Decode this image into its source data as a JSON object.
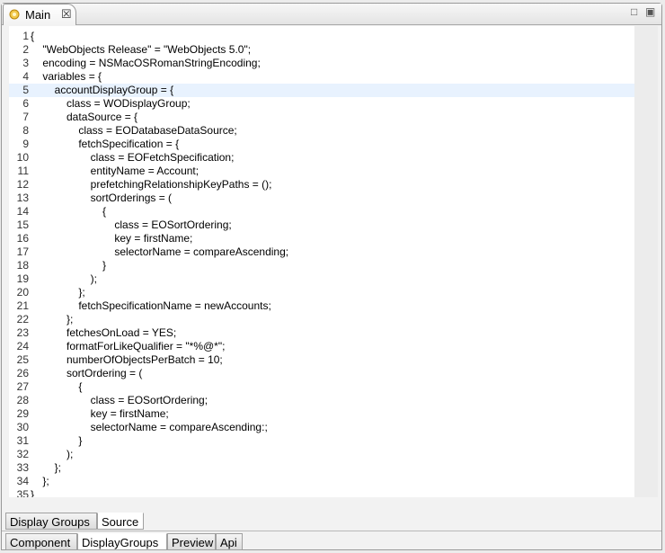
{
  "tab": {
    "title": "Main",
    "close_glyph": "☒"
  },
  "window_controls": {
    "minimize": "□",
    "maximize": "▣"
  },
  "editor": {
    "current_line": 5,
    "lines": [
      "{",
      "    \"WebObjects Release\" = \"WebObjects 5.0\";",
      "    encoding = NSMacOSRomanStringEncoding;",
      "    variables = {",
      "        accountDisplayGroup = {",
      "            class = WODisplayGroup;",
      "            dataSource = {",
      "                class = EODatabaseDataSource;",
      "                fetchSpecification = {",
      "                    class = EOFetchSpecification;",
      "                    entityName = Account;",
      "                    prefetchingRelationshipKeyPaths = ();",
      "                    sortOrderings = (",
      "                        {",
      "                            class = EOSortOrdering;",
      "                            key = firstName;",
      "                            selectorName = compareAscending;",
      "                        }",
      "                    );",
      "                };",
      "                fetchSpecificationName = newAccounts;",
      "            };",
      "            fetchesOnLoad = YES;",
      "            formatForLikeQualifier = \"*%@*\";",
      "            numberOfObjectsPerBatch = 10;",
      "            sortOrdering = (",
      "                {",
      "                    class = EOSortOrdering;",
      "                    key = firstName;",
      "                    selectorName = compareAscending:;",
      "                }",
      "            );",
      "        };",
      "    };",
      "}"
    ]
  },
  "sub_tabs": [
    {
      "label": "Display Groups",
      "active": false
    },
    {
      "label": "Source",
      "active": true
    }
  ],
  "bottom_tabs": [
    {
      "label": "Component",
      "active": false
    },
    {
      "label": "DisplayGroups",
      "active": true
    },
    {
      "label": "Preview",
      "active": false
    },
    {
      "label": "Api",
      "active": false
    }
  ],
  "icons": {
    "tab_icon": "component-icon"
  },
  "colors": {
    "current_line_bg": "#e8f2fe"
  }
}
